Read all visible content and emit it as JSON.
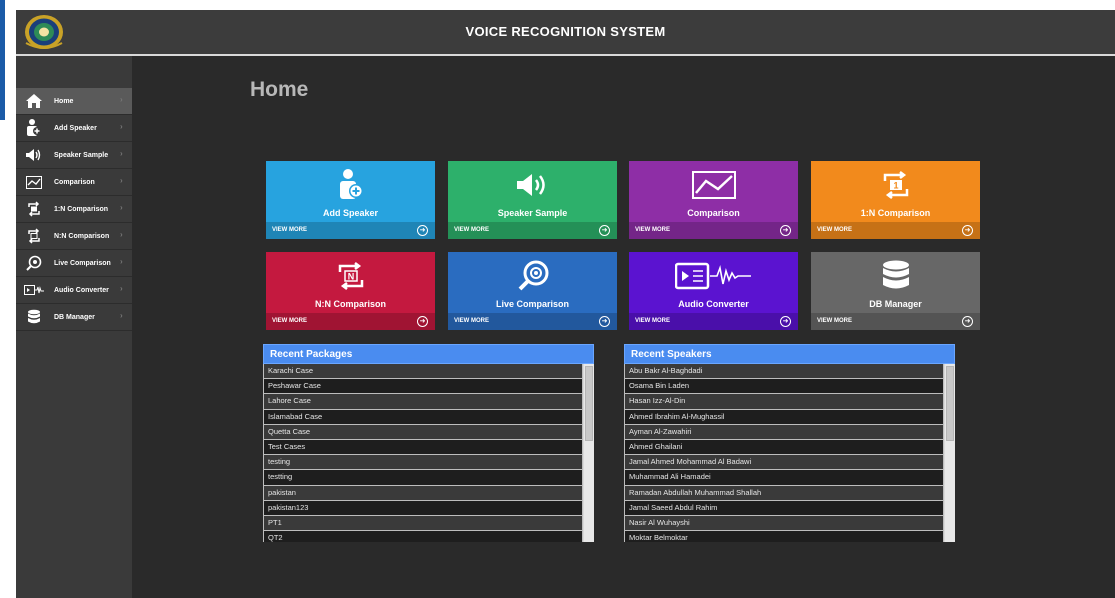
{
  "app": {
    "title": "VOICE RECOGNITION SYSTEM",
    "page_title": "Home"
  },
  "colors": {
    "window_bg": "#2a2a2a",
    "titlebar_bg": "#3c3c3c",
    "sidebar_bg": "#3a3a3a",
    "panel_header": "#4a8cf0"
  },
  "sidebar": {
    "items": [
      {
        "label": "Home",
        "icon": "home-icon",
        "active": true
      },
      {
        "label": "Add Speaker",
        "icon": "add-user-icon",
        "active": false
      },
      {
        "label": "Speaker Sample",
        "icon": "speaker-icon",
        "active": false
      },
      {
        "label": "Comparison",
        "icon": "chart-icon",
        "active": false
      },
      {
        "label": "1:N Comparison",
        "icon": "one-to-n-icon",
        "active": false
      },
      {
        "label": "N:N Comparison",
        "icon": "n-to-n-icon",
        "active": false
      },
      {
        "label": "Live Comparison",
        "icon": "live-search-icon",
        "active": false
      },
      {
        "label": "Audio Converter",
        "icon": "audio-converter-icon",
        "active": false
      },
      {
        "label": "DB Manager",
        "icon": "database-icon",
        "active": false
      }
    ]
  },
  "tiles": [
    {
      "label": "Add Speaker",
      "more": "VIEW MORE",
      "icon": "add-user-icon",
      "color": "#27a3df"
    },
    {
      "label": "Speaker Sample",
      "more": "VIEW MORE",
      "icon": "speaker-icon",
      "color": "#2db06b"
    },
    {
      "label": "Comparison",
      "more": "VIEW MORE",
      "icon": "chart-icon",
      "color": "#8e2ea6"
    },
    {
      "label": "1:N Comparison",
      "more": "VIEW MORE",
      "icon": "one-to-n-icon",
      "color": "#f28a1c"
    },
    {
      "label": "N:N Comparison",
      "more": "VIEW MORE",
      "icon": "n-to-n-icon",
      "color": "#c4193f"
    },
    {
      "label": "Live Comparison",
      "more": "VIEW MORE",
      "icon": "live-search-icon",
      "color": "#2a6cc0"
    },
    {
      "label": "Audio Converter",
      "more": "VIEW MORE",
      "icon": "audio-converter-icon",
      "color": "#5b13d0"
    },
    {
      "label": "DB Manager",
      "more": "VIEW MORE",
      "icon": "database-icon",
      "color": "#676767"
    }
  ],
  "recent_packages": {
    "title": "Recent Packages",
    "items": [
      "Karachi Case",
      "Peshawar Case",
      "Lahore Case",
      "Islamabad Case",
      "Quetta Case",
      "Test Cases",
      "testing",
      "testting",
      "pakistan",
      "pakistan123",
      "PT1",
      "QT2"
    ]
  },
  "recent_speakers": {
    "title": "Recent Speakers",
    "items": [
      "Abu Bakr Al-Baghdadi",
      "Osama Bin Laden",
      "Hasan Izz-Al-Din",
      "Ahmed Ibrahim Al-Mughassil",
      "Ayman Al-Zawahiri",
      "Ahmed Ghailani",
      "Jamal Ahmed Mohammad Al Badawi",
      "Muhammad Ali Hamadei",
      "Ramadan Abdullah Muhammad Shallah",
      "Jamal Saeed Abdul Rahim",
      "Nasir Al Wuhayshi",
      "Moktar Belmoktar"
    ]
  }
}
